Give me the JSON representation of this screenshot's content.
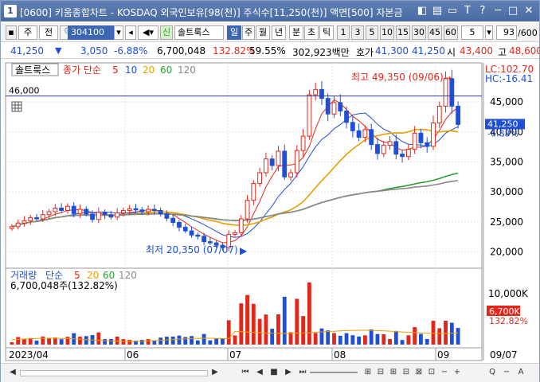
{
  "window": {
    "number": "1",
    "title": "[0600] 키움종합차트 - KOSDAQ 외국인보유[98(천)] 주식수[11,250(천)] 액면[500] 자본금",
    "buttons": [
      "◧",
      "▤",
      "▭",
      "T",
      "?",
      "─",
      "□",
      "✕"
    ]
  },
  "toolbar": {
    "code": "304100",
    "period_label": "주",
    "prev_label": "전",
    "indicator_label": "솔트룩스",
    "indicator_prefix": "신",
    "periods": [
      "일",
      "주",
      "월",
      "년",
      "분",
      "초",
      "틱"
    ],
    "active_period": "일",
    "intervals": [
      "1",
      "3",
      "5",
      "10",
      "15",
      "30",
      "45",
      "60"
    ],
    "interval_value": "5",
    "count_value": "93",
    "count_total": "/600"
  },
  "quote": {
    "price": "41,250",
    "change": "3,050",
    "change_pct": "-6.88%",
    "volume": "6,700,048",
    "vol_ratio": "132.82%",
    "turnover_pct": "59.55%",
    "amount": "302,923백만",
    "bid_label": "호가",
    "bid": "41,300",
    "ask": "41,250",
    "open_label": "시",
    "open": "43,400",
    "high_label": "고",
    "high": "48,600"
  },
  "price_panel": {
    "name_tag": "솔트룩스",
    "ma_legend_prefix": "종가 단순",
    "ma_periods": [
      "5",
      "10",
      "20",
      "60",
      "120"
    ],
    "ma_colors": [
      "#e4261a",
      "#1f4fd6",
      "#e6a100",
      "#2e9d3a",
      "#888888"
    ],
    "ref_level_label": "46,000",
    "lc_label": "LC:102.70",
    "hc_label": "HC:-16.41",
    "current_tag": "41,250",
    "current_pct": "-6.88%",
    "max_label": "최고 49,350 (09/06)",
    "min_label": "최저 20,350 (07/07)",
    "y_ticks": [
      "45,000",
      "40,000",
      "35,000",
      "30,000",
      "25,000",
      "20,000"
    ]
  },
  "volume_panel": {
    "legend_prefix": "거래량",
    "ma_legend_prefix": "단순",
    "ma_periods": [
      "5",
      "20",
      "60",
      "120"
    ],
    "volume_text": "6,700,048주(132.82%)",
    "y_ticks": [
      "10,000K",
      "5,000K"
    ],
    "current_tag": "6,700K",
    "current_pct": "132.82%"
  },
  "x_axis": {
    "labels": [
      "2023/04",
      "06",
      "07",
      "08",
      "09",
      "09/07"
    ]
  },
  "bottombar": {
    "buttons": [
      "◀",
      "▶",
      "⏮",
      "◀",
      "■",
      "▶",
      "⏭",
      "⊞",
      "⊟",
      "⊞",
      "⊟",
      "⊠",
      "⊡",
      "−",
      "+",
      "Q",
      "−",
      "A"
    ]
  },
  "chart_data": {
    "type": "candlestick",
    "title": "솔트룩스",
    "x": [
      "2023/04",
      "06",
      "07",
      "08",
      "09"
    ],
    "y_axis_ticks": [
      45000,
      40000,
      35000,
      30000,
      25000,
      20000
    ],
    "ylim": [
      17800,
      51000
    ],
    "reference_line": 46000,
    "max": {
      "value": 49350,
      "date": "09/06"
    },
    "min": {
      "value": 20350,
      "date": "07/07"
    },
    "series": [
      {
        "name": "close",
        "values": [
          24200,
          24800,
          25200,
          25700,
          25500,
          26200,
          26700,
          27300,
          26900,
          27600,
          26400,
          27100,
          26300,
          25400,
          26600,
          26200,
          25800,
          26500,
          26900,
          27200,
          27000,
          26700,
          27100,
          26900,
          26300,
          25600,
          24900,
          24100,
          23500,
          22800,
          22600,
          21700,
          21500,
          21100,
          20700,
          22900,
          23200,
          25500,
          28600,
          31400,
          33200,
          35500,
          34400,
          36800,
          32500,
          33200,
          36900,
          39300,
          46200,
          47100,
          45600,
          43000,
          44900,
          43500,
          41600,
          40200,
          39100,
          40400,
          37900,
          36400,
          37800,
          38400,
          36300,
          35900,
          37100,
          39800,
          38200,
          37600,
          41500,
          44300,
          48900,
          44300,
          41250
        ]
      },
      {
        "name": "ma5",
        "values": []
      }
    ]
  }
}
